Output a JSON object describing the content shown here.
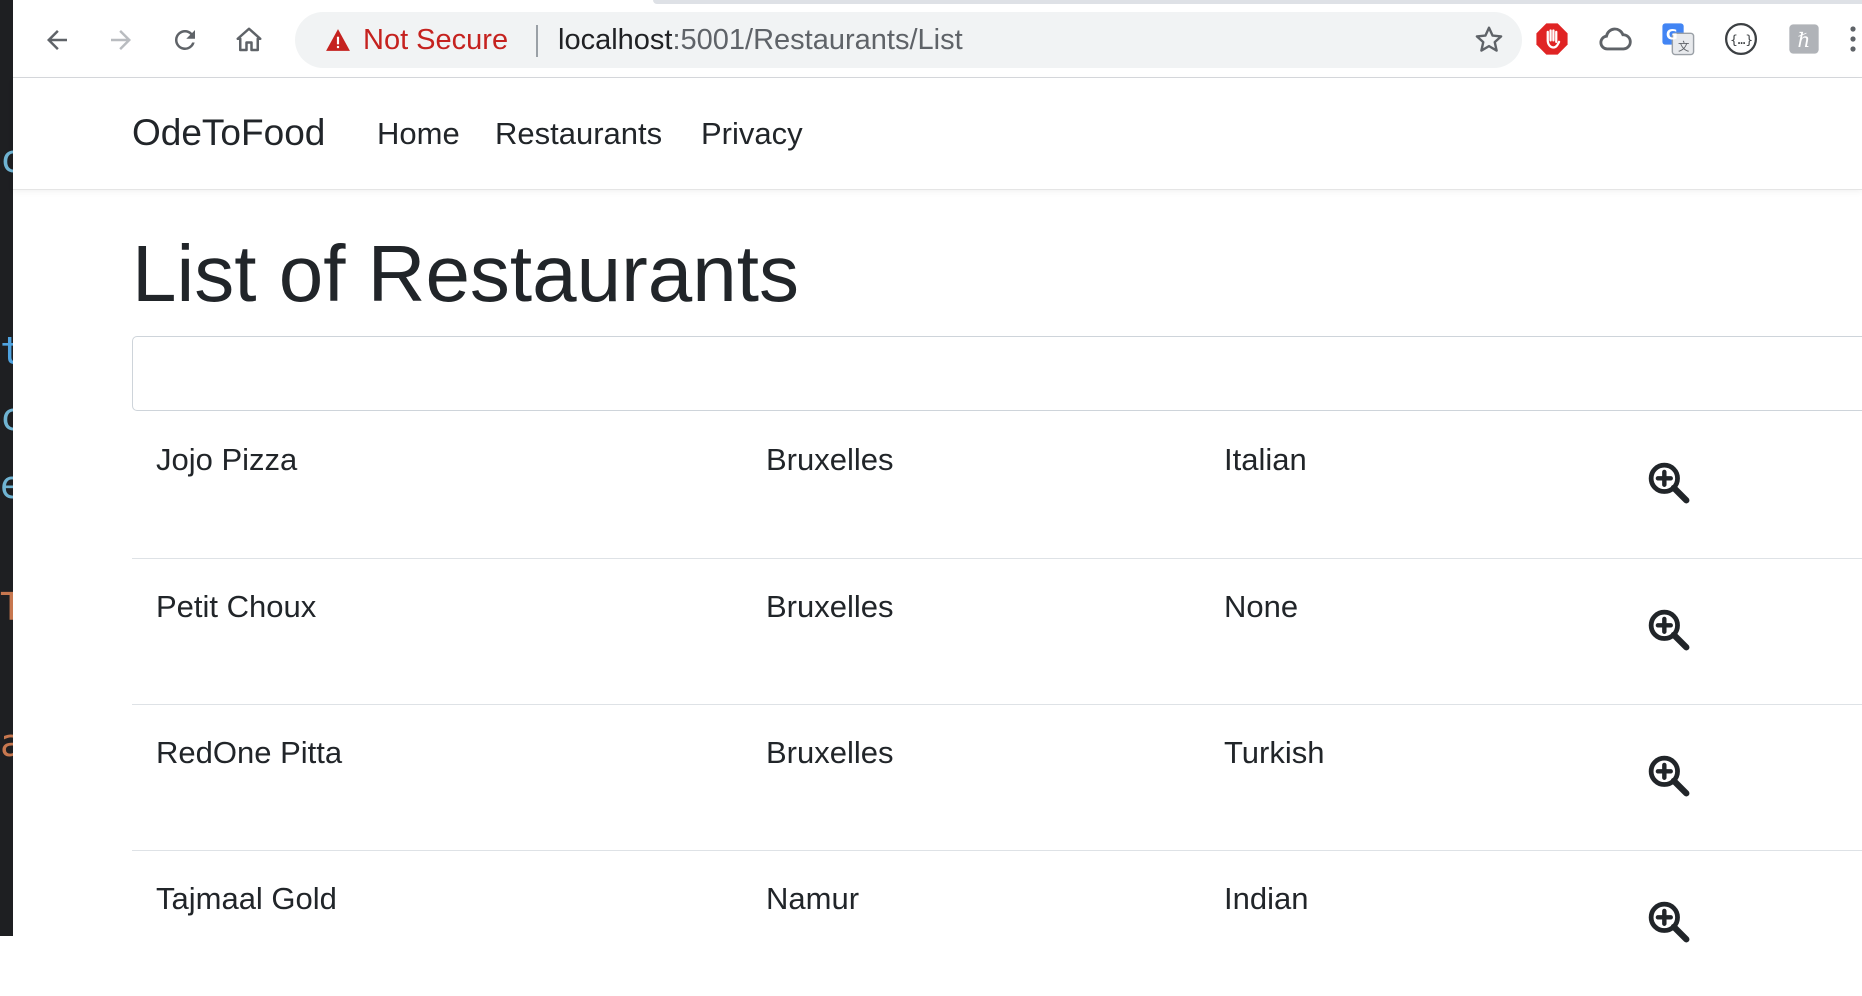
{
  "browser": {
    "security_label": "Not Secure",
    "url_host": "localhost",
    "url_rest": ":5001/Restaurants/List"
  },
  "site": {
    "brand": "OdeToFood",
    "nav": [
      "Home",
      "Restaurants",
      "Privacy"
    ]
  },
  "page": {
    "title": "List of Restaurants",
    "search": {
      "value": "",
      "placeholder": ""
    }
  },
  "restaurants": {
    "rows": [
      {
        "name": "Jojo Pizza",
        "location": "Bruxelles",
        "cuisine": "Italian"
      },
      {
        "name": "Petit Choux",
        "location": "Bruxelles",
        "cuisine": "None"
      },
      {
        "name": "RedOne Pitta",
        "location": "Bruxelles",
        "cuisine": "Turkish"
      },
      {
        "name": "Tajmaal Gold",
        "location": "Namur",
        "cuisine": "Indian"
      }
    ]
  },
  "icons": {
    "back": "arrow-left-icon",
    "forward": "arrow-right-icon",
    "reload": "reload-icon",
    "home": "home-icon",
    "warning": "warning-triangle-icon",
    "bookmark": "star-icon",
    "details": "zoom-in-icon"
  },
  "colors": {
    "security_warning": "#c5221f",
    "text": "#212529",
    "row_border": "#dee2e6"
  }
}
